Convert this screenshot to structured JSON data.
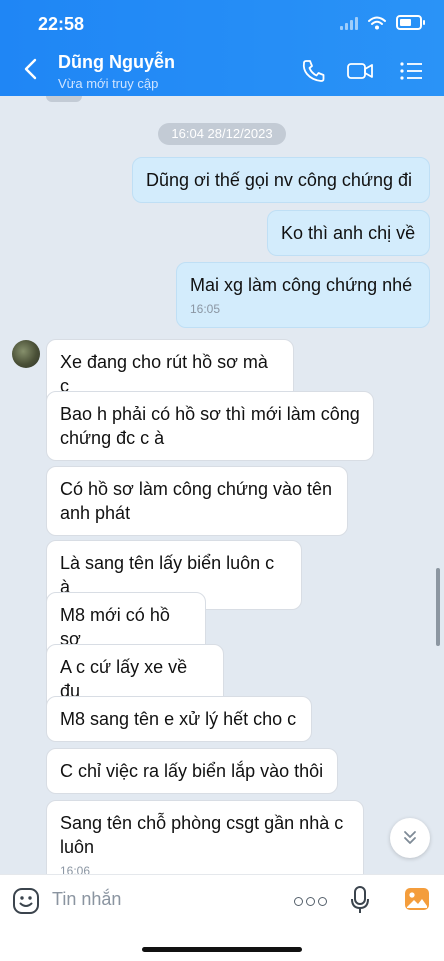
{
  "status_bar": {
    "time": "22:58"
  },
  "header": {
    "contact_name": "Dũng Nguyễn",
    "contact_status": "Vừa mới truy cập"
  },
  "chat": {
    "date_divider": "16:04 28/12/2023",
    "outgoing": [
      {
        "text": "Dũng ơi thế gọi nv công chứng đi"
      },
      {
        "text": "Ko thì anh chị về"
      },
      {
        "text": "Mai xg làm công chứng nhé",
        "time": "16:05"
      }
    ],
    "incoming": [
      {
        "text": "Xe đang cho rút hồ sơ mà c"
      },
      {
        "text": "Bao h phải có hồ sơ thì mới làm công chứng đc c à"
      },
      {
        "text": "Có hồ sơ làm công chứng vào tên anh phát"
      },
      {
        "text": "Là sang tên lấy biển luôn c à"
      },
      {
        "text": "M8 mới có hồ sơ"
      },
      {
        "text": "A c cứ lấy xe về đu"
      },
      {
        "text": "M8 sang tên e xử lý hết cho c"
      },
      {
        "text": "C chỉ việc ra lấy biển lắp vào thôi"
      },
      {
        "text": "Sang tên chỗ phòng csgt gần nhà c luôn",
        "time": "16:06"
      }
    ]
  },
  "input": {
    "placeholder": "Tin nhắn"
  },
  "colors": {
    "header": "#1f86f5",
    "outgoing_bubble": "#d3ecfc",
    "incoming_bubble": "#ffffff",
    "background": "#e2e9f1"
  },
  "icons": {
    "back": "chevron-left-icon",
    "call": "phone-icon",
    "video": "video-camera-icon",
    "menu": "list-menu-icon",
    "emoji": "emoji-icon",
    "more": "more-dots-icon",
    "mic": "microphone-icon",
    "photo": "photo-icon",
    "scroll": "double-chevron-down-icon"
  }
}
